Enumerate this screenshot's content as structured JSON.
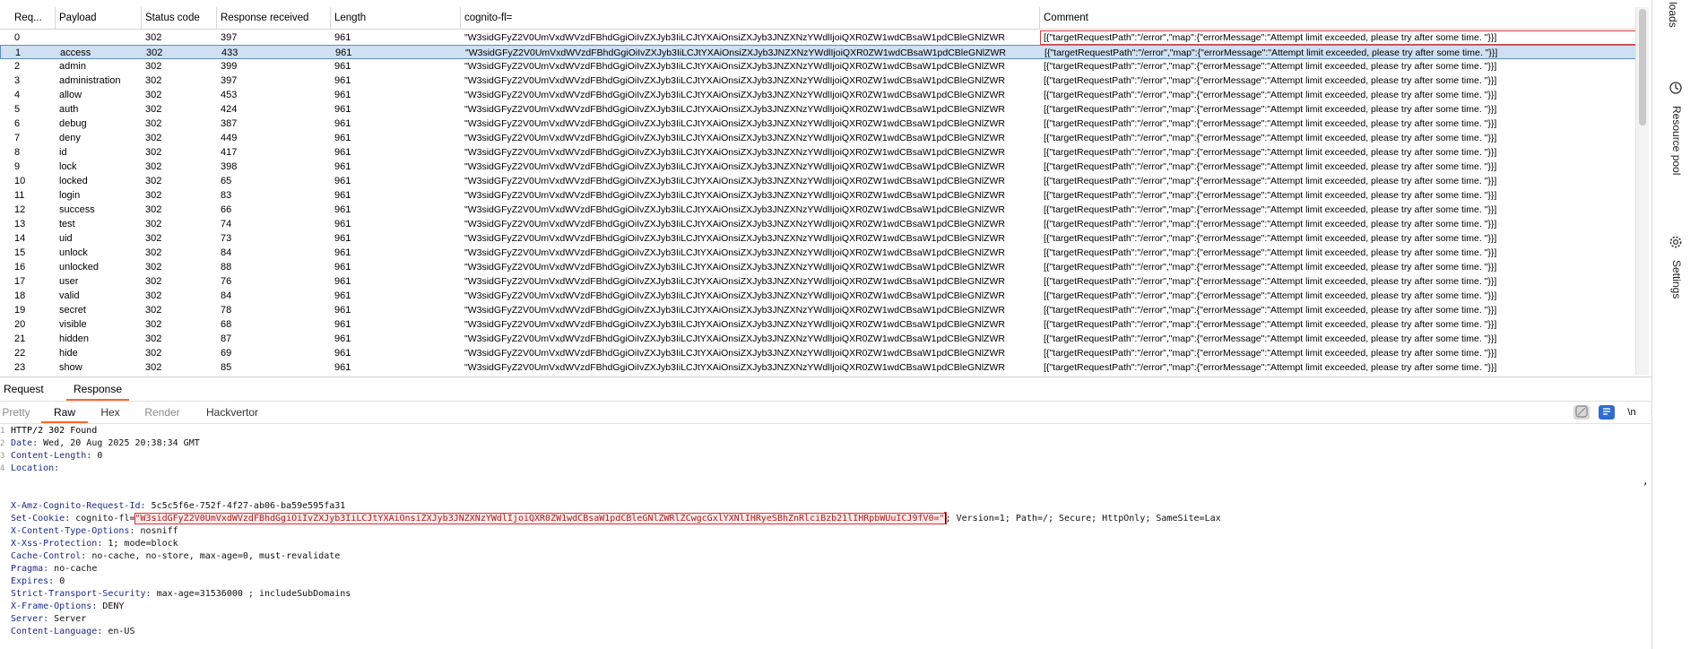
{
  "table": {
    "headers": [
      "Req...",
      "Payload",
      "Status code",
      "Response received",
      "Length",
      "cognito-fl=",
      "Comment"
    ],
    "token": "\"W3sidGFyZ2V0UmVxdWVzdFBhdGgiOiIvZXJyb3IiLCJtYXAiOnsiZXJyb3JNZXNzYWdlIjoiQXR0ZW1wdCBsaW1pdCBleGNlZWR",
    "comment": "[{\"targetRequestPath\":\"/error\",\"map\":{\"errorMessage\":\"Attempt limit exceeded, please try after some time. \"}}]",
    "rows": [
      {
        "req": "0",
        "payload": "",
        "status": "302",
        "received": "397",
        "length": "961"
      },
      {
        "req": "1",
        "payload": "access",
        "status": "302",
        "received": "433",
        "length": "961"
      },
      {
        "req": "2",
        "payload": "admin",
        "status": "302",
        "received": "399",
        "length": "961"
      },
      {
        "req": "3",
        "payload": "administration",
        "status": "302",
        "received": "397",
        "length": "961"
      },
      {
        "req": "4",
        "payload": "allow",
        "status": "302",
        "received": "453",
        "length": "961"
      },
      {
        "req": "5",
        "payload": "auth",
        "status": "302",
        "received": "424",
        "length": "961"
      },
      {
        "req": "6",
        "payload": "debug",
        "status": "302",
        "received": "387",
        "length": "961"
      },
      {
        "req": "7",
        "payload": "deny",
        "status": "302",
        "received": "449",
        "length": "961"
      },
      {
        "req": "8",
        "payload": "id",
        "status": "302",
        "received": "417",
        "length": "961"
      },
      {
        "req": "9",
        "payload": "lock",
        "status": "302",
        "received": "398",
        "length": "961"
      },
      {
        "req": "10",
        "payload": "locked",
        "status": "302",
        "received": "65",
        "length": "961"
      },
      {
        "req": "11",
        "payload": "login",
        "status": "302",
        "received": "83",
        "length": "961"
      },
      {
        "req": "12",
        "payload": "success",
        "status": "302",
        "received": "66",
        "length": "961"
      },
      {
        "req": "13",
        "payload": "test",
        "status": "302",
        "received": "74",
        "length": "961"
      },
      {
        "req": "14",
        "payload": "uid",
        "status": "302",
        "received": "73",
        "length": "961"
      },
      {
        "req": "15",
        "payload": "unlock",
        "status": "302",
        "received": "84",
        "length": "961"
      },
      {
        "req": "16",
        "payload": "unlocked",
        "status": "302",
        "received": "88",
        "length": "961"
      },
      {
        "req": "17",
        "payload": "user",
        "status": "302",
        "received": "76",
        "length": "961"
      },
      {
        "req": "18",
        "payload": "valid",
        "status": "302",
        "received": "84",
        "length": "961"
      },
      {
        "req": "19",
        "payload": "secret",
        "status": "302",
        "received": "78",
        "length": "961"
      },
      {
        "req": "20",
        "payload": "visible",
        "status": "302",
        "received": "68",
        "length": "961"
      },
      {
        "req": "21",
        "payload": "hidden",
        "status": "302",
        "received": "87",
        "length": "961"
      },
      {
        "req": "22",
        "payload": "hide",
        "status": "302",
        "received": "69",
        "length": "961"
      },
      {
        "req": "23",
        "payload": "show",
        "status": "302",
        "received": "85",
        "length": "961"
      }
    ]
  },
  "tabs": {
    "request": "Request",
    "response": "Response"
  },
  "subtabs": {
    "pretty": "Pretty",
    "raw": "Raw",
    "hex": "Hex",
    "render": "Render",
    "hackvertor": "Hackvertor"
  },
  "toolbar": {
    "newline_label": "\\n",
    "menu_label": "≡"
  },
  "response": {
    "status_line": "HTTP/2 302 Found",
    "headers": [
      {
        "name": "Date",
        "value": "Wed, 20 Aug 2025 20:38:34 GMT"
      },
      {
        "name": "Content-Length",
        "value": "0"
      },
      {
        "name": "Location",
        "value": ""
      }
    ],
    "marker": ",",
    "amz_header": {
      "name": "X-Amz-Cognito-Request-Id",
      "value": "5c5c5f6e-752f-4f27-ab06-ba59e595fa31"
    },
    "set_cookie_name": "Set-Cookie",
    "set_cookie_prefix": "cognito-fl=",
    "set_cookie_value": "\"W3sidGFyZ2V0UmVxdWVzdFBhdGgiOiIvZXJyb3IiLCJtYXAiOnsiZXJyb3JNZXNzYWdlIjoiQXR0ZW1wdCBsaW1pdCBleGNlZWRlZCwgcGxlYXNlIHRyeSBhZnRlciBzb21lIHRpbWUuICJ9fV0=\"",
    "set_cookie_suffix": "; Version=1; Path=/; Secure; HttpOnly; SameSite=Lax",
    "headers2": [
      {
        "name": "X-Content-Type-Options",
        "value": "nosniff"
      },
      {
        "name": "X-Xss-Protection",
        "value": "1; mode=block"
      },
      {
        "name": "Cache-Control",
        "value": "no-cache, no-store, max-age=0, must-revalidate"
      },
      {
        "name": "Pragma",
        "value": "no-cache"
      },
      {
        "name": "Expires",
        "value": "0"
      },
      {
        "name": "Strict-Transport-Security",
        "value": "max-age=31536000 ; includeSubDomains"
      },
      {
        "name": "X-Frame-Options",
        "value": "DENY"
      },
      {
        "name": "Server",
        "value": "Server"
      },
      {
        "name": "Content-Language",
        "value": "en-US"
      }
    ]
  },
  "side_panel": {
    "items": [
      {
        "label": "loads",
        "icon": "downloads-icon"
      },
      {
        "label": "Resource pool",
        "icon": "resource-pool-icon"
      },
      {
        "label": "Settings",
        "icon": "gear-icon"
      }
    ]
  }
}
